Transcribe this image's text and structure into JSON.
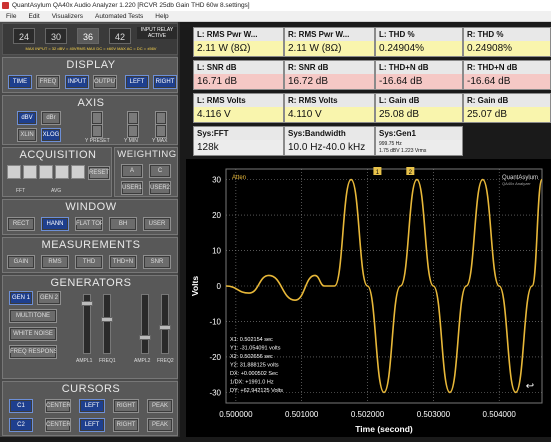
{
  "window": {
    "title": "QuantAsylum QA40x Audio Analyzer 1.220 [RCVR 25db Gain THD 60w 8.settings]"
  },
  "menu": [
    "File",
    "Edit",
    "Visualizers",
    "Automated Tests",
    "Help"
  ],
  "top": {
    "fft_values": [
      "24",
      "30",
      "36",
      "42"
    ],
    "selected": "36",
    "input_relay_line1": "INPUT RELAY",
    "input_relay_line2": "ACTIVE",
    "status_line": "MAX INPUT = 32 dBV = 40VRMS   MAX DC = ±60V   MAX AC = DC = ±56V"
  },
  "display": {
    "header": "DISPLAY",
    "buttons": [
      "TIME",
      "FREQ",
      "INPUT",
      "OUTPUT",
      "LEFT",
      "RIGHT"
    ]
  },
  "axis": {
    "header": "AXIS",
    "buttons": [
      "dBV",
      "dBr",
      "XLIN",
      "XLOG"
    ],
    "labels": [
      "Y PRESET",
      "Y MIN",
      "Y MAX"
    ]
  },
  "acquisition": {
    "header": "ACQUISITION",
    "reset": "RESET",
    "fft_label": "FFT",
    "avg_label": "AVG"
  },
  "weighting": {
    "header": "WEIGHTING",
    "buttons": [
      "A",
      "C",
      "USER1",
      "USER2",
      "USER"
    ]
  },
  "window_sec": {
    "header": "WINDOW",
    "buttons": [
      "RECT",
      "HANN",
      "FLAT TOP",
      "BH",
      "USER"
    ]
  },
  "measurements": {
    "header": "MEASUREMENTS",
    "buttons": [
      "GAIN",
      "RMS",
      "THD",
      "THD+N",
      "SNR"
    ]
  },
  "generators": {
    "header": "GENERATORS",
    "buttons": [
      "GEN 1",
      "GEN 2",
      "MULTITONE",
      "WHITE NOISE",
      "FREQ RESPONSE"
    ],
    "labels": [
      "AMPL1",
      "FREQ1",
      "AMPL2",
      "FREQ2"
    ]
  },
  "cursors": {
    "header": "CURSORS",
    "rows": [
      {
        "name": "C1",
        "buttons": [
          "CENTER",
          "LEFT",
          "RIGHT",
          "PEAK"
        ]
      },
      {
        "name": "C2",
        "buttons": [
          "CENTER",
          "LEFT",
          "RIGHT",
          "PEAK"
        ]
      }
    ]
  },
  "meters": [
    {
      "label": "L: RMS Pwr W...",
      "value": "2.11 W (8Ω)",
      "style": "yel"
    },
    {
      "label": "R: RMS Pwr W...",
      "value": "2.11 W (8Ω)",
      "style": "yel"
    },
    {
      "label": "L: THD %",
      "value": "0.24904%",
      "style": "yel"
    },
    {
      "label": "R: THD %",
      "value": "0.24908%",
      "style": "yel"
    },
    {
      "label": "L: SNR dB",
      "value": "16.71 dB",
      "style": "pink"
    },
    {
      "label": "R: SNR dB",
      "value": "16.72 dB",
      "style": "pink"
    },
    {
      "label": "L: THD+N dB",
      "value": "-16.64 dB",
      "style": "pink"
    },
    {
      "label": "R: THD+N dB",
      "value": "-16.64 dB",
      "style": "pink"
    },
    {
      "label": "L: RMS Volts",
      "value": "4.116 V",
      "style": "yel"
    },
    {
      "label": "R: RMS Volts",
      "value": "4.110 V",
      "style": "yel"
    },
    {
      "label": "L: Gain dB",
      "value": "25.08 dB",
      "style": "yel"
    },
    {
      "label": "R: Gain dB",
      "value": "25.07 dB",
      "style": "yel"
    },
    {
      "label": "Sys:FFT",
      "value": "128k",
      "style": "grey"
    },
    {
      "label": "Sys:Bandwidth",
      "value": "10.0 Hz-40.0 kHz",
      "style": "grey"
    },
    {
      "label": "Sys:Gen1",
      "value": "",
      "sub1": "999.75 Hz",
      "sub2": "1.75 dBV  1.223 Vrms",
      "style": "grey"
    }
  ],
  "chart_data": {
    "type": "line",
    "xlabel": "Time (second)",
    "ylabel": "Volts",
    "ylim": [
      -33,
      33
    ],
    "xlim": [
      0.49985,
      0.50465
    ],
    "x_ticks": [
      "0.500000",
      "0.501000",
      "0.502000",
      "0.503000",
      "0.504000"
    ],
    "x_tick_values": [
      0.5,
      0.501,
      0.502,
      0.503,
      0.504
    ],
    "y_ticks": [
      30,
      20,
      10,
      0,
      -10,
      -20,
      -30
    ],
    "grid": true,
    "series": [
      {
        "name": "",
        "color": "#e8b839",
        "x": [
          0.49985,
          0.5002,
          0.5005,
          0.5009,
          0.5012,
          0.50135,
          0.5015,
          0.50175,
          0.502,
          0.50225,
          0.5025,
          0.50275,
          0.503,
          0.50325,
          0.5035,
          0.50375,
          0.504,
          0.50425,
          0.5045,
          0.50465
        ],
        "y": [
          0,
          -2,
          3,
          -4,
          3,
          0,
          0,
          30,
          0,
          -30,
          0,
          30,
          0,
          -30,
          0,
          30,
          0,
          -30,
          0,
          30
        ]
      }
    ],
    "annotations": {
      "top_left": "Atten",
      "brand": "QuantAsylum",
      "brand_sub": "QA40x Analyzer",
      "markers": [
        "1",
        "2"
      ],
      "cursor_readout": [
        "X1: 0.502154 sec",
        "Y1: -31.054091 volts",
        "X2: 0.502656 sec",
        "Y2: 31.888125 volts",
        "DX: +0.000502 Sec",
        "1/DX: +1991.0 Hz",
        "DY: +62.942125 Volts"
      ]
    }
  }
}
